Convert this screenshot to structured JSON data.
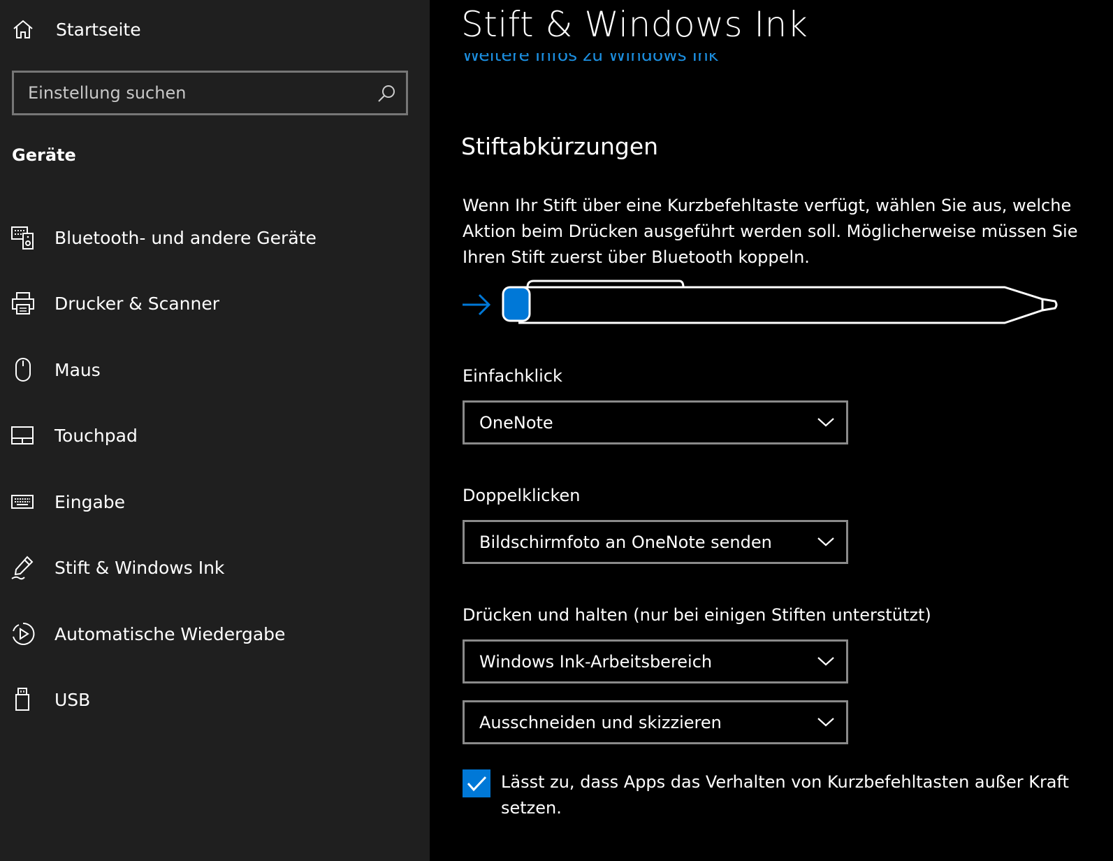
{
  "sidebar": {
    "home_label": "Startseite",
    "search_placeholder": "Einstellung suchen",
    "section_title": "Geräte",
    "items": [
      {
        "label": "Bluetooth- und andere Geräte",
        "icon": "bluetooth-devices-icon"
      },
      {
        "label": "Drucker & Scanner",
        "icon": "printer-icon"
      },
      {
        "label": "Maus",
        "icon": "mouse-icon"
      },
      {
        "label": "Touchpad",
        "icon": "touchpad-icon"
      },
      {
        "label": "Eingabe",
        "icon": "keyboard-icon"
      },
      {
        "label": "Stift & Windows Ink",
        "icon": "pen-icon"
      },
      {
        "label": "Automatische Wiedergabe",
        "icon": "autoplay-icon"
      },
      {
        "label": "USB",
        "icon": "usb-icon"
      }
    ]
  },
  "main": {
    "title": "Stift & Windows Ink",
    "link": "Weitere Infos zu Windows Ink",
    "subheading": "Stiftabkürzungen",
    "description": "Wenn Ihr Stift über eine Kurzbefehltaste verfügt, wählen Sie aus, welche Aktion beim Drücken ausgeführt werden soll. Möglicherweise müssen Sie Ihren Stift zuerst über Bluetooth koppeln.",
    "single_click_label": "Einfachklick",
    "single_click_value": "OneNote",
    "double_click_label": "Doppelklicken",
    "double_click_value": "Bildschirmfoto an OneNote senden",
    "press_hold_label": "Drücken und halten (nur bei einigen Stiften unterstützt)",
    "press_hold_value": "Windows Ink-Arbeitsbereich",
    "press_hold_value2": "Ausschneiden und skizzieren",
    "checkbox_label": "Lässt zu, dass Apps das Verhalten von Kurzbefehltasten außer Kraft setzen.",
    "checkbox_checked": true
  },
  "colors": {
    "accent": "#0078d7",
    "link": "#1c8fe0",
    "sidebar_bg": "#1f1f1f",
    "main_bg": "#000000"
  }
}
